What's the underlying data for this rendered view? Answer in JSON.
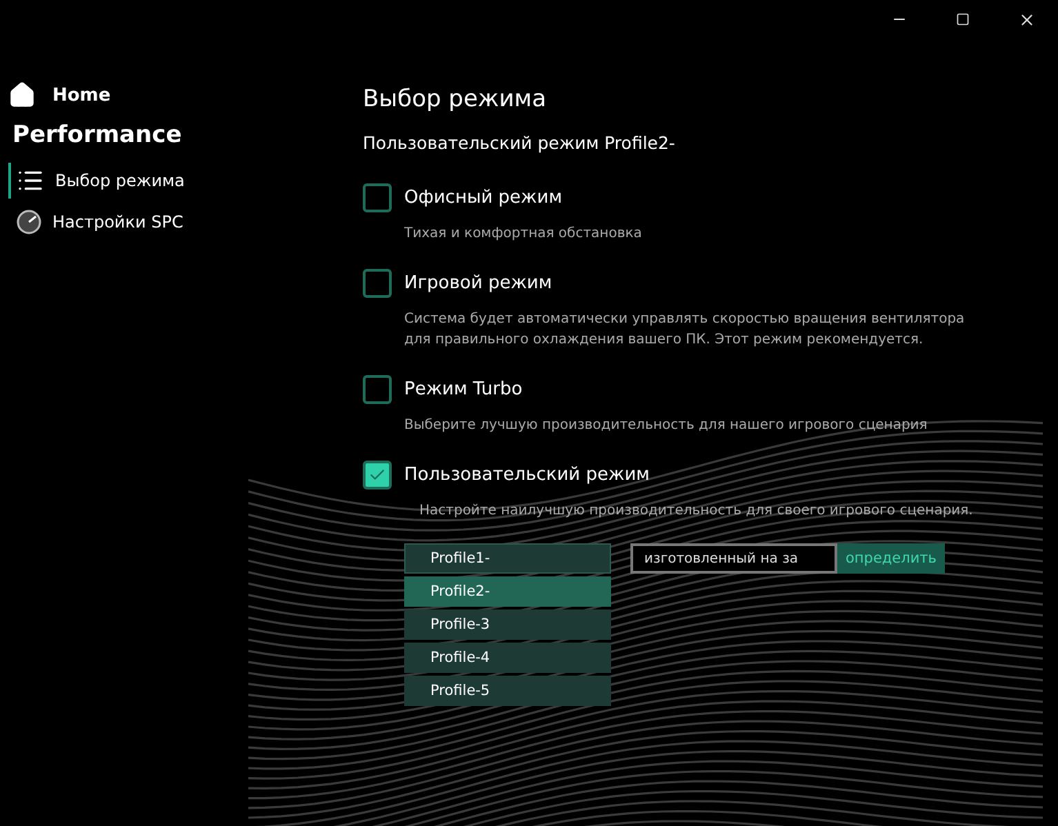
{
  "nav": {
    "home": "Home",
    "section": "Performance",
    "items": [
      {
        "label": "Выбор режима",
        "kind": "list",
        "selected": true
      },
      {
        "label": "Настройки SPC",
        "kind": "gauge",
        "selected": false
      }
    ]
  },
  "page": {
    "title": "Выбор режима",
    "subtitle": "Пользовательский режим Profile2-"
  },
  "modes": [
    {
      "label": "Офисный режим",
      "description": "Тихая и комфортная обстановка",
      "checked": false
    },
    {
      "label": "Игровой режим",
      "description": "Система будет автоматически управлять скоростью вращения вентилятора для правильного охлаждения вашего ПК. Этот режим рекомендуется.",
      "checked": false
    },
    {
      "label": "Режим Turbo",
      "description": "Выберите лучшую производительность для нашего игрового сценария",
      "checked": false
    },
    {
      "label": "Пользовательский режим",
      "description": "Настройте наилучшую производительность для своего игрового сценария.",
      "checked": true
    }
  ],
  "profile_select": {
    "value": "Profile1-",
    "options": [
      {
        "label": "Profile2-",
        "selected": true
      },
      {
        "label": "Profile-3",
        "selected": false
      },
      {
        "label": "Profile-4",
        "selected": false
      },
      {
        "label": "Profile-5",
        "selected": false
      }
    ]
  },
  "name_field": {
    "value": "изготовленный на за"
  },
  "define_button": "определить"
}
